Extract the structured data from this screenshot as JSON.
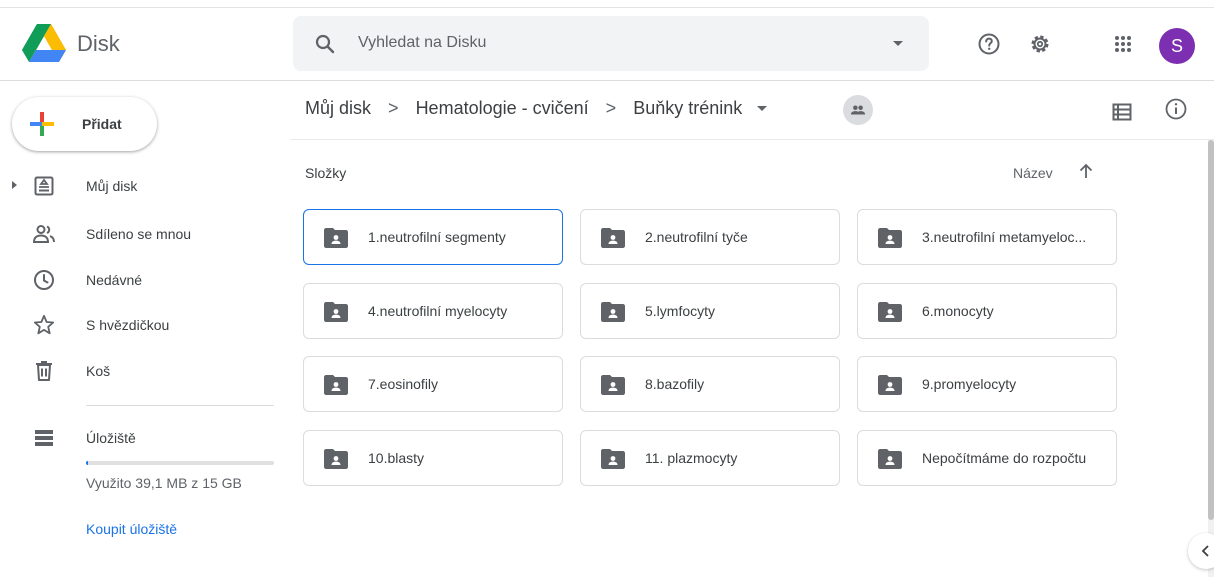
{
  "app": {
    "name": "Disk"
  },
  "search": {
    "placeholder": "Vyhledat na Disku"
  },
  "header_icons": [
    "help-icon",
    "settings-icon",
    "apps-grid-icon"
  ],
  "user": {
    "avatar_letter": "S",
    "avatar_color": "#7c2fb0"
  },
  "new_button": {
    "label": "Přidat"
  },
  "sidebar": {
    "items": [
      {
        "label": "Můj disk",
        "icon": "my-drive-icon"
      },
      {
        "label": "Sdíleno se mnou",
        "icon": "shared-icon"
      },
      {
        "label": "Nedávné",
        "icon": "clock-icon"
      },
      {
        "label": "S hvězdičkou",
        "icon": "star-icon"
      },
      {
        "label": "Koš",
        "icon": "trash-icon"
      }
    ],
    "storage": {
      "label": "Úložiště",
      "used_text": "Využito 39,1 MB z 15 GB",
      "used_fraction": 0.0025,
      "buy_label": "Koupit úložiště"
    }
  },
  "breadcrumb": {
    "items": [
      "Můj disk",
      "Hematologie - cvičení",
      "Buňky trénink"
    ],
    "separator": ">"
  },
  "main": {
    "section_label": "Složky",
    "sort_label": "Název",
    "folders": [
      "1.neutrofilní segmenty",
      "2.neutrofilní tyče",
      "3.neutrofilní metamyeloc...",
      "4.neutrofilní myelocyty",
      "5.lymfocyty",
      "6.monocyty",
      "7.eosinofily",
      "8.bazofily",
      "9.promyelocyty",
      "10.blasty",
      "11. plazmocyty",
      "Nepočítmáme do rozpočtu"
    ],
    "selected_index": 0
  },
  "colors": {
    "accent": "#1a73e8",
    "folder_icon": "#5f6368"
  }
}
